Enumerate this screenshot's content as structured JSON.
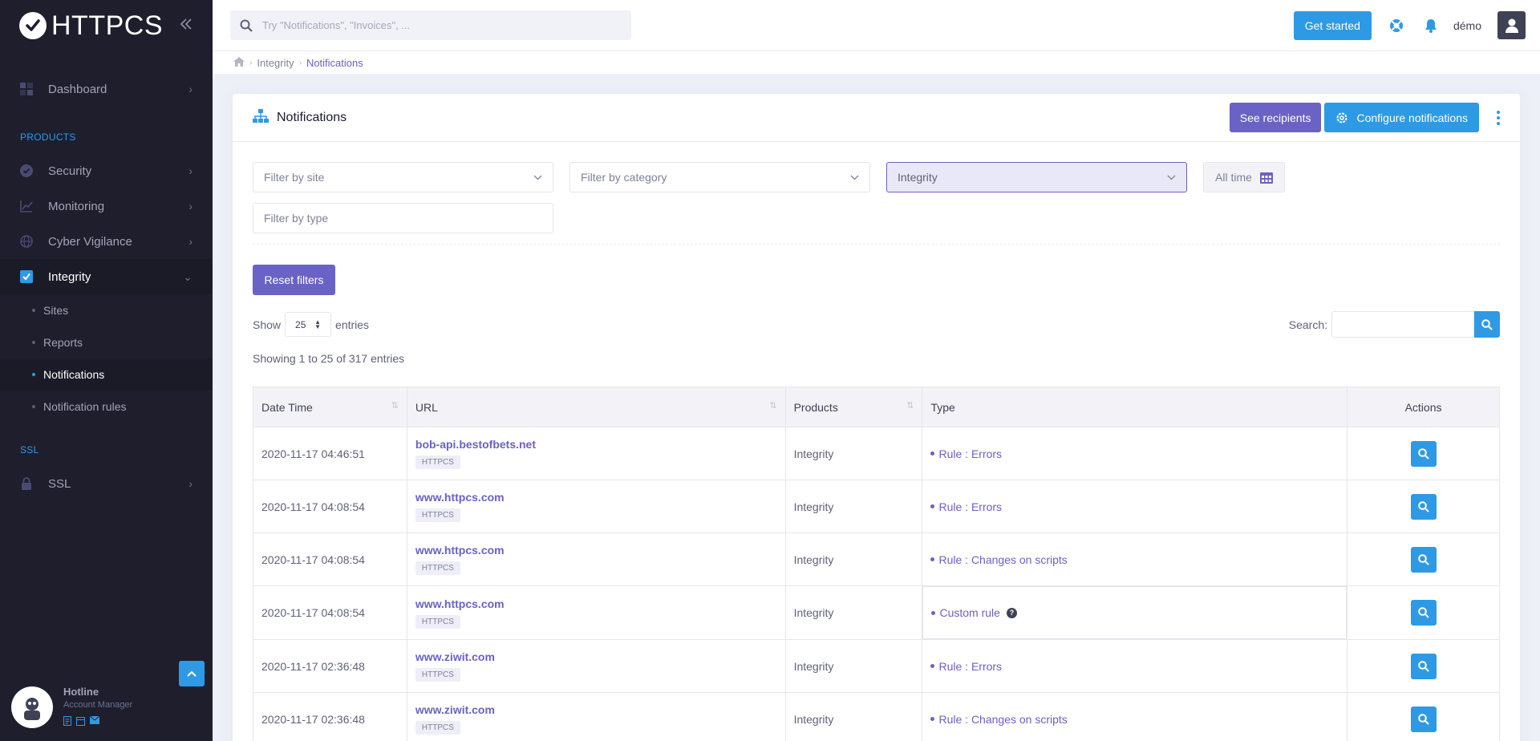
{
  "app": {
    "logo_text": "HTTPCS"
  },
  "search": {
    "placeholder": "Try \"Notifications\", \"Invoices\", ..."
  },
  "header": {
    "get_started": "Get started",
    "user": "démo"
  },
  "sidebar": {
    "dashboard": "Dashboard",
    "products_label": "PRODUCTS",
    "security": "Security",
    "monitoring": "Monitoring",
    "cyber": "Cyber Vigilance",
    "integrity": "Integrity",
    "sub": [
      "Sites",
      "Reports",
      "Notifications",
      "Notification rules"
    ],
    "ssl_label": "SSL",
    "ssl": "SSL"
  },
  "hotline": {
    "name": "Hotline",
    "role": "Account Manager"
  },
  "breadcrumb": {
    "parent": "Integrity",
    "current": "Notifications"
  },
  "card": {
    "title": "Notifications",
    "see_recipients": "See recipients",
    "configure": "Configure notifications"
  },
  "filters": {
    "site": "Filter by site",
    "category": "Filter by category",
    "product": "Integrity",
    "time": "All time",
    "type": "Filter by type",
    "reset": "Reset filters"
  },
  "table_controls": {
    "show": "Show",
    "length": "25",
    "entries": "entries",
    "search_label": "Search:",
    "info": "Showing 1 to 25 of 317 entries"
  },
  "table": {
    "headers": [
      "Date Time",
      "URL",
      "Products",
      "Type",
      "Actions"
    ],
    "rows": [
      {
        "date": "2020-11-17 04:46:51",
        "url": "bob-api.bestofbets.net",
        "tag": "HTTPCS",
        "product": "Integrity",
        "type": "Rule : Errors"
      },
      {
        "date": "2020-11-17 04:08:54",
        "url": "www.httpcs.com",
        "tag": "HTTPCS",
        "product": "Integrity",
        "type": "Rule : Errors"
      },
      {
        "date": "2020-11-17 04:08:54",
        "url": "www.httpcs.com",
        "tag": "HTTPCS",
        "product": "Integrity",
        "type": "Rule : Changes on scripts"
      },
      {
        "date": "2020-11-17 04:08:54",
        "url": "www.httpcs.com",
        "tag": "HTTPCS",
        "product": "Integrity",
        "type": "Custom rule"
      },
      {
        "date": "2020-11-17 02:36:48",
        "url": "www.ziwit.com",
        "tag": "HTTPCS",
        "product": "Integrity",
        "type": "Rule : Errors"
      },
      {
        "date": "2020-11-17 02:36:48",
        "url": "www.ziwit.com",
        "tag": "HTTPCS",
        "product": "Integrity",
        "type": "Rule : Changes on scripts"
      }
    ]
  },
  "colors": {
    "accent_blue": "#2e9ae5",
    "accent_purple": "#6a62c4",
    "sidebar_bg": "#1e1e2d"
  }
}
